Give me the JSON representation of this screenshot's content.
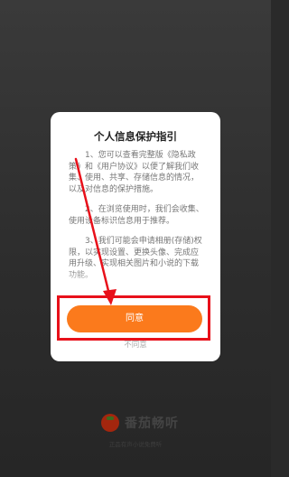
{
  "dialog": {
    "title": "个人信息保护指引",
    "paragraphs": [
      "1、您可以查看完整版《隐私政策》和《用户协议》以便了解我们收集、使用、共享、存储信息的情况，以及对信息的保护措施。",
      "2、在浏览使用时，我们会收集、使用设备标识信息用于推荐。",
      "3、我们可能会申请相册(存储)权限，以实现设置、更换头像、完成应用升级、实现相关图片和小说的下载功能。"
    ],
    "agree_label": "同意",
    "disagree_label": "不同意"
  },
  "brand": {
    "name": "番茄畅听",
    "caption": "正品有声小说免费听"
  },
  "colors": {
    "accent": "#fb7a1c",
    "highlight": "#e8101a"
  }
}
